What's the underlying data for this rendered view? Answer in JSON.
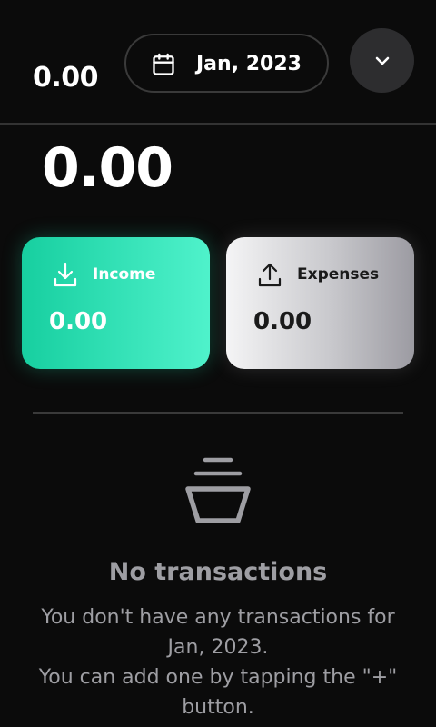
{
  "header": {
    "balance": "0.00",
    "date_label": "Jan, 2023"
  },
  "summary": {
    "balance": "0.00"
  },
  "cards": {
    "income": {
      "label": "Income",
      "value": "0.00"
    },
    "expenses": {
      "label": "Expenses",
      "value": "0.00"
    }
  },
  "empty_state": {
    "title": "No transactions",
    "line1": "You don't have any transactions for Jan, 2023.",
    "line2": "You can add one by tapping the \"+\" button."
  },
  "icons": {
    "calendar": "calendar-icon",
    "expand": "chevron-down-icon",
    "income": "download-icon",
    "expenses": "upload-icon",
    "empty": "empty-basket-icon"
  },
  "colors": {
    "background": "#0b0b0b",
    "income_start": "#17cfa0",
    "income_end": "#4ff2cb",
    "expenses_start": "#f4f4f5",
    "expenses_end": "#9c9ba2",
    "muted_text": "#9e9ea3"
  }
}
